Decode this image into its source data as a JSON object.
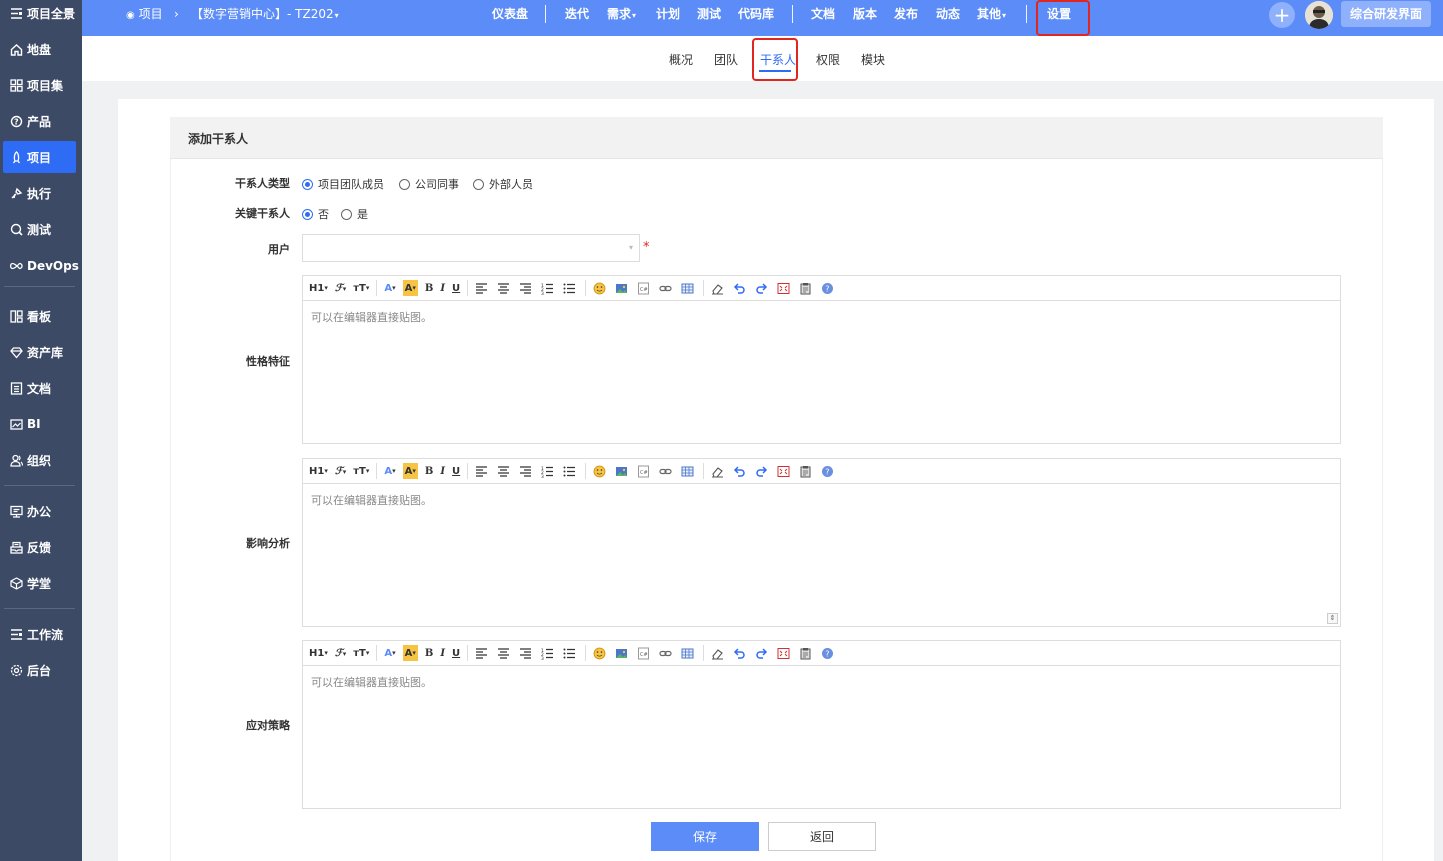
{
  "sidebar": {
    "items": [
      {
        "label": "项目全景",
        "icon": "overview-icon"
      },
      {
        "label": "地盘",
        "icon": "home-icon"
      },
      {
        "label": "项目集",
        "icon": "grid-icon"
      },
      {
        "label": "产品",
        "icon": "product-icon"
      },
      {
        "label": "项目",
        "icon": "project-icon"
      },
      {
        "label": "执行",
        "icon": "run-icon"
      },
      {
        "label": "测试",
        "icon": "test-icon"
      },
      {
        "label": "DevOps",
        "icon": "infinity-icon"
      },
      {
        "label": "看板",
        "icon": "kanban-icon"
      },
      {
        "label": "资产库",
        "icon": "diamond-icon"
      },
      {
        "label": "文档",
        "icon": "doc-icon"
      },
      {
        "label": "BI",
        "icon": "bi-icon"
      },
      {
        "label": "组织",
        "icon": "org-icon"
      },
      {
        "label": "办公",
        "icon": "office-icon"
      },
      {
        "label": "反馈",
        "icon": "feedback-icon"
      },
      {
        "label": "学堂",
        "icon": "academy-icon"
      },
      {
        "label": "工作流",
        "icon": "workflow-icon"
      },
      {
        "label": "后台",
        "icon": "settings-icon"
      }
    ]
  },
  "topbar": {
    "breadcrumb_root": "项目",
    "breadcrumb_project": "【数字营销中心】- TZ202",
    "nav": [
      "仪表盘",
      "迭代",
      "需求",
      "计划",
      "测试",
      "代码库",
      "文档",
      "版本",
      "发布",
      "动态",
      "其他",
      "设置"
    ],
    "switch_label": "综合研发界面"
  },
  "subnav": {
    "tabs": [
      "概况",
      "团队",
      "干系人",
      "权限",
      "模块"
    ]
  },
  "form": {
    "title": "添加干系人",
    "type_label": "干系人类型",
    "type_options": [
      "项目团队成员",
      "公司同事",
      "外部人员"
    ],
    "key_label": "关键干系人",
    "key_options": [
      "否",
      "是"
    ],
    "user_label": "用户",
    "user_value": "",
    "required_mark": "*",
    "editors": [
      {
        "label": "性格特征",
        "placeholder": "可以在编辑器直接贴图。"
      },
      {
        "label": "影响分析",
        "placeholder": "可以在编辑器直接贴图。"
      },
      {
        "label": "应对策略",
        "placeholder": "可以在编辑器直接贴图。"
      }
    ],
    "toolbar": {
      "heading": "H1",
      "font": "ℱ",
      "size": "тT",
      "bold": "B",
      "italic": "I",
      "underline": "U",
      "fontcolor": "A",
      "bgcolor": "A"
    },
    "save_label": "保存",
    "back_label": "返回"
  },
  "colors": {
    "accent": "#5b8cf7",
    "sidebar_bg": "#3c4a66",
    "active_item": "#2e6cf6",
    "highlight": "#e0261f"
  }
}
